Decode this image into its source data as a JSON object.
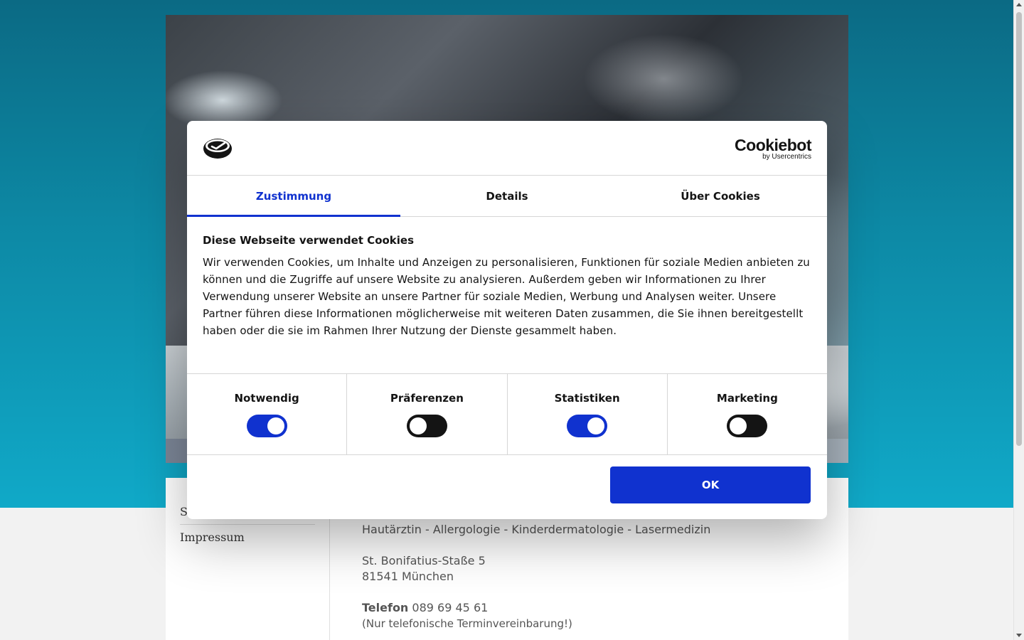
{
  "site": {
    "nav": {
      "partial_item": "S",
      "impressum": "Impressum"
    },
    "practice": {
      "specialties": "Hautärztin - Allergologie - Kinderdermatologie - Lasermedizin",
      "street": "St. Bonifatius-Staße 5",
      "city": "81541 München",
      "phone_label": "Telefon",
      "phone": "089 69 45 61",
      "phone_note": "(Nur telefonische Terminvereinbarung!)"
    }
  },
  "cookie_dialog": {
    "brand": {
      "name": "Cookiebot",
      "sub": "by Usercentrics"
    },
    "tabs": [
      {
        "label": "Zustimmung",
        "active": true
      },
      {
        "label": "Details",
        "active": false
      },
      {
        "label": "Über Cookies",
        "active": false
      }
    ],
    "title": "Diese Webseite verwendet Cookies",
    "text": "Wir verwenden Cookies, um Inhalte und Anzeigen zu personalisieren, Funktionen für soziale Medien anbieten zu können und die Zugriffe auf unsere Website zu analysieren. Außerdem geben wir Informationen zu Ihrer Verwendung unserer Website an unsere Partner für soziale Medien, Werbung und Analysen weiter. Unsere Partner führen diese Informationen möglicherweise mit weiteren Daten zusammen, die Sie ihnen bereitgestellt haben oder die sie im Rahmen Ihrer Nutzung der Dienste gesammelt haben.",
    "toggles": [
      {
        "label": "Notwendig",
        "on": true
      },
      {
        "label": "Präferenzen",
        "on": false
      },
      {
        "label": "Statistiken",
        "on": true
      },
      {
        "label": "Marketing",
        "on": false
      }
    ],
    "ok_label": "OK",
    "colors": {
      "accent": "#1032cf",
      "toggle_off": "#141414"
    }
  }
}
